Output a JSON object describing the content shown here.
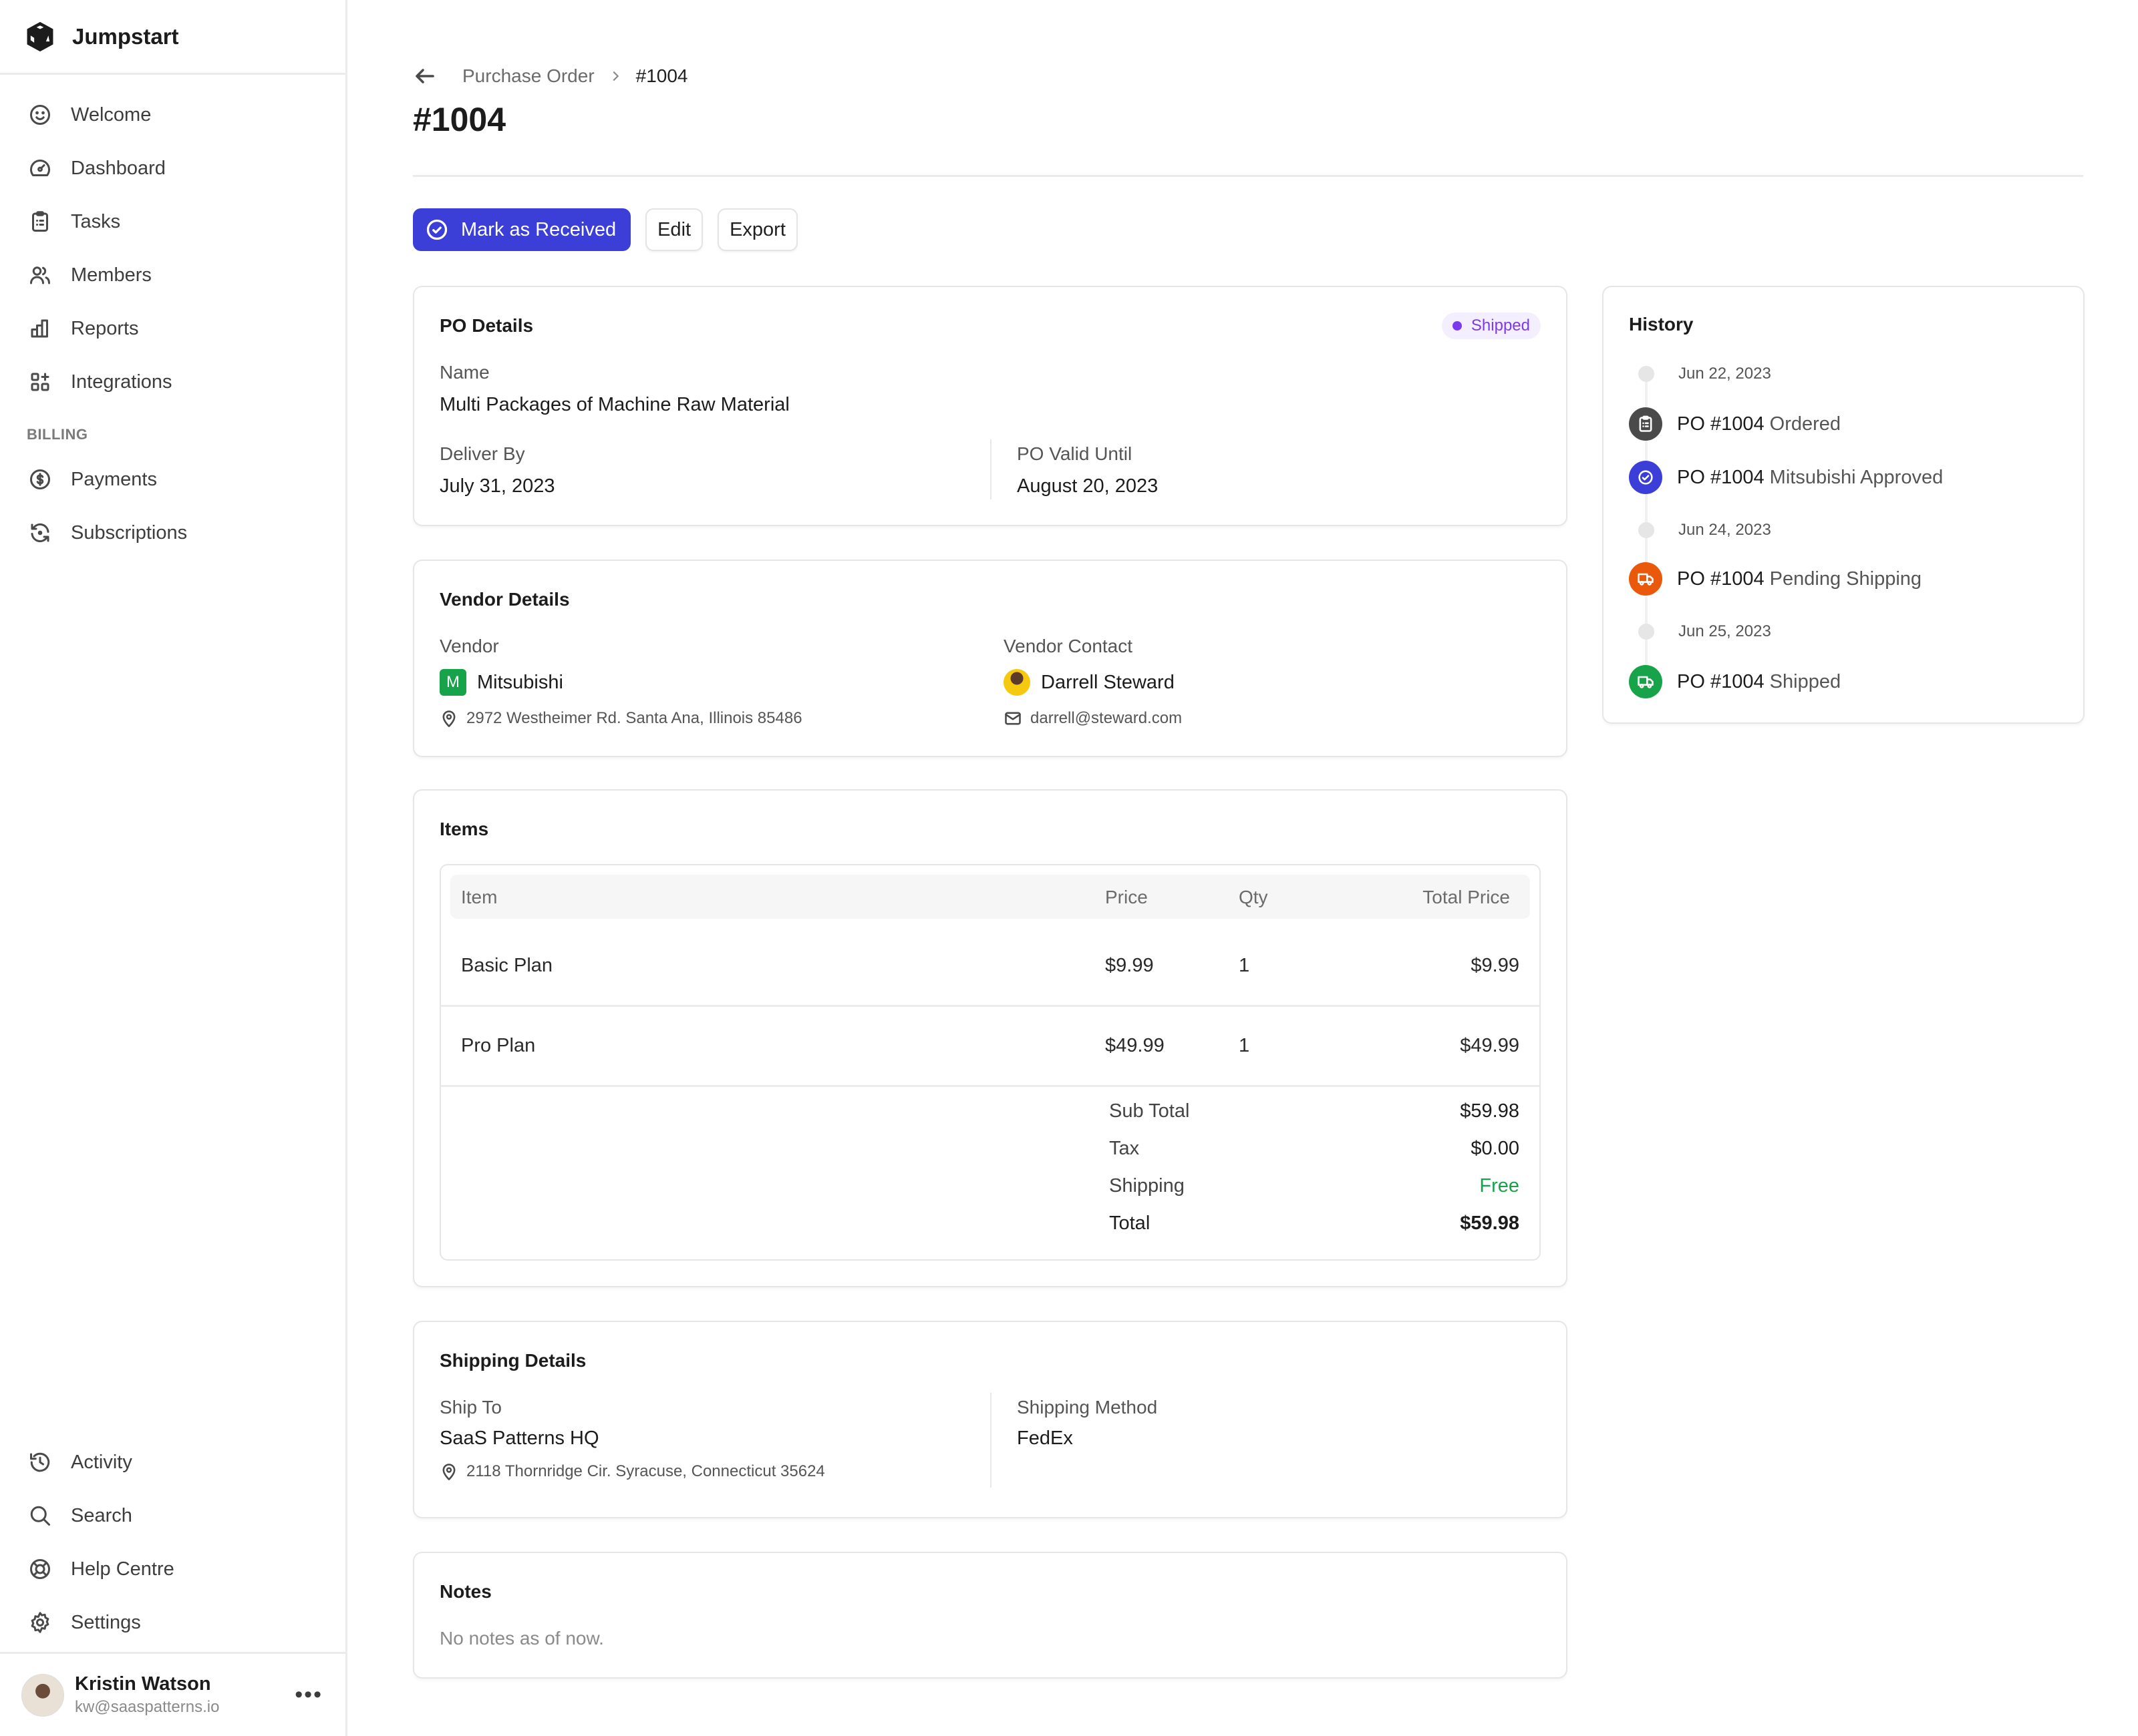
{
  "app": {
    "name": "Jumpstart"
  },
  "sidebar": {
    "items": [
      {
        "label": "Welcome",
        "icon": "smile-icon"
      },
      {
        "label": "Dashboard",
        "icon": "gauge-icon"
      },
      {
        "label": "Tasks",
        "icon": "clipboard-icon"
      },
      {
        "label": "Members",
        "icon": "users-icon"
      },
      {
        "label": "Reports",
        "icon": "bar-chart-icon"
      },
      {
        "label": "Integrations",
        "icon": "grid-plus-icon"
      }
    ],
    "billing_section": "BILLING",
    "billing_items": [
      {
        "label": "Payments",
        "icon": "dollar-circle-icon"
      },
      {
        "label": "Subscriptions",
        "icon": "refresh-icon"
      }
    ],
    "bottom_items": [
      {
        "label": "Activity",
        "icon": "history-icon"
      },
      {
        "label": "Search",
        "icon": "search-icon"
      },
      {
        "label": "Help Centre",
        "icon": "lifebuoy-icon"
      },
      {
        "label": "Settings",
        "icon": "gear-icon"
      }
    ],
    "user": {
      "name": "Kristin Watson",
      "email": "kw@saaspatterns.io",
      "menu": "•••"
    }
  },
  "header": {
    "breadcrumb": {
      "parent": "Purchase Order",
      "current": "#1004"
    },
    "title": "#1004"
  },
  "actions": {
    "mark_received": "Mark as Received",
    "edit": "Edit",
    "export": "Export"
  },
  "colors": {
    "primary": "#3b3fd8",
    "shipped_badge": "#7c3aed",
    "free": "#16a34a"
  },
  "po_details": {
    "title": "PO Details",
    "status": "Shipped",
    "name_label": "Name",
    "name_value": "Multi Packages of Machine Raw Material",
    "deliver_by_label": "Deliver By",
    "deliver_by_value": "July 31, 2023",
    "valid_until_label": "PO Valid Until",
    "valid_until_value": "August 20, 2023"
  },
  "vendor_details": {
    "title": "Vendor Details",
    "vendor_label": "Vendor",
    "vendor_logo_letter": "M",
    "vendor_name": "Mitsubishi",
    "vendor_address": "2972 Westheimer Rd. Santa Ana, Illinois 85486",
    "contact_label": "Vendor Contact",
    "contact_name": "Darrell Steward",
    "contact_email": "darrell@steward.com"
  },
  "items": {
    "title": "Items",
    "columns": [
      "Item",
      "Price",
      "Qty",
      "Total Price"
    ],
    "rows": [
      {
        "item": "Basic Plan",
        "price": "$9.99",
        "qty": "1",
        "total": "$9.99"
      },
      {
        "item": "Pro Plan",
        "price": "$49.99",
        "qty": "1",
        "total": "$49.99"
      }
    ],
    "summary": {
      "subtotal_label": "Sub Total",
      "subtotal": "$59.98",
      "tax_label": "Tax",
      "tax": "$0.00",
      "shipping_label": "Shipping",
      "shipping": "Free",
      "total_label": "Total",
      "total": "$59.98"
    }
  },
  "shipping_details": {
    "title": "Shipping Details",
    "ship_to_label": "Ship To",
    "ship_to_value": "SaaS Patterns HQ",
    "ship_to_address": "2118 Thornridge Cir. Syracuse, Connecticut 35624",
    "method_label": "Shipping Method",
    "method_value": "FedEx"
  },
  "notes": {
    "title": "Notes",
    "text": "No notes as of now."
  },
  "history": {
    "title": "History",
    "entries": [
      {
        "type": "date",
        "text": "Jun 22, 2023"
      },
      {
        "type": "event",
        "po": "PO #1004",
        "action": "Ordered",
        "icon": "clipboard-icon",
        "color": "#4a4a4a"
      },
      {
        "type": "event",
        "po": "PO #1004",
        "action": "Mitsubishi Approved",
        "icon": "check-circle-icon",
        "color": "#3b3fd8"
      },
      {
        "type": "date",
        "text": "Jun 24, 2023"
      },
      {
        "type": "event",
        "po": "PO #1004",
        "action": "Pending Shipping",
        "icon": "truck-icon",
        "color": "#ea580c"
      },
      {
        "type": "date",
        "text": "Jun 25, 2023"
      },
      {
        "type": "event",
        "po": "PO #1004",
        "action": "Shipped",
        "icon": "truck-icon",
        "color": "#16a34a"
      }
    ]
  }
}
